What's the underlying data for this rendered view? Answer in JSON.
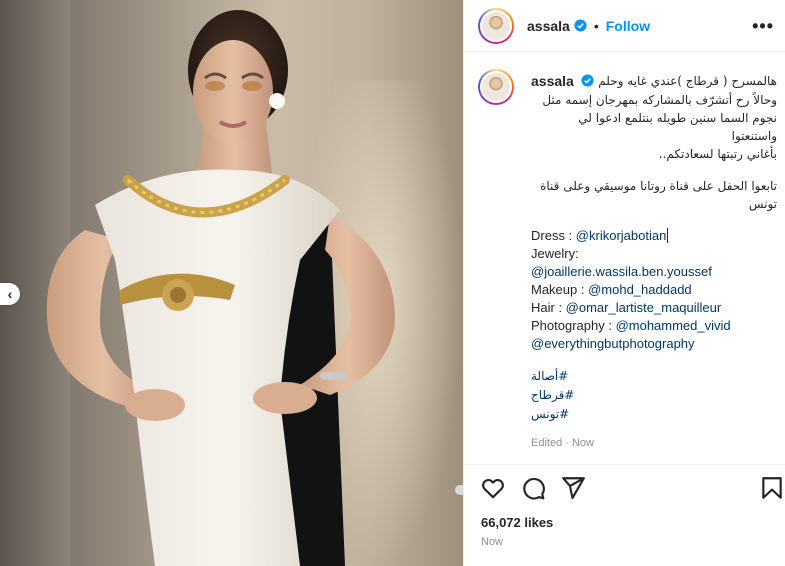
{
  "post": {
    "username": "assala",
    "follow_label": "Follow",
    "header_separator": "•",
    "more_label": "•••",
    "prev_label": "‹"
  },
  "caption": {
    "arabic_lines": [
      "هالمسرح ( قرطاج )عندي غايه وحلم",
      "وحالاً رح أتشرّف بالمشاركه بمهرجان إسمه مثل",
      "نجوم السما سنين طويله بنتلمع ادعوا لي واستنعتوا",
      "بأغاني رتبتها لسعادتكم.."
    ],
    "arabic_follow_lines": [
      "تابعوا الحفل على قناة روتانا موسيقي وعلى قناة",
      "تونس"
    ],
    "credits": {
      "dress_label": "Dress : ",
      "dress_handle": "@krikorjabotian",
      "jewelry_label": "Jewelry:",
      "jewelry_handle": "@joaillerie.wassila.ben.youssef",
      "makeup_label": "Makeup : ",
      "makeup_handle": "@mohd_haddadd",
      "hair_label": "Hair : ",
      "hair_handle": "@omar_lartiste_maquilleur",
      "photo_label": "Photography : ",
      "photo_handle": "@mohammed_vivid",
      "photo_handle_2": "@everythingbutphotography"
    },
    "hashtags": [
      "#أصالة",
      "#قرطاج",
      "#تونس"
    ],
    "edited": "Edited · Now"
  },
  "engagement": {
    "likes": "66,072 likes",
    "time": "Now"
  },
  "icons": [
    "heart-icon",
    "comment-icon",
    "share-icon",
    "bookmark-icon",
    "verified-badge-icon",
    "more-options-icon",
    "chevron-left-icon"
  ],
  "colors": {
    "accent": "#0095f6",
    "link": "#00376b",
    "muted": "#8e8e8e",
    "text": "#262626"
  }
}
